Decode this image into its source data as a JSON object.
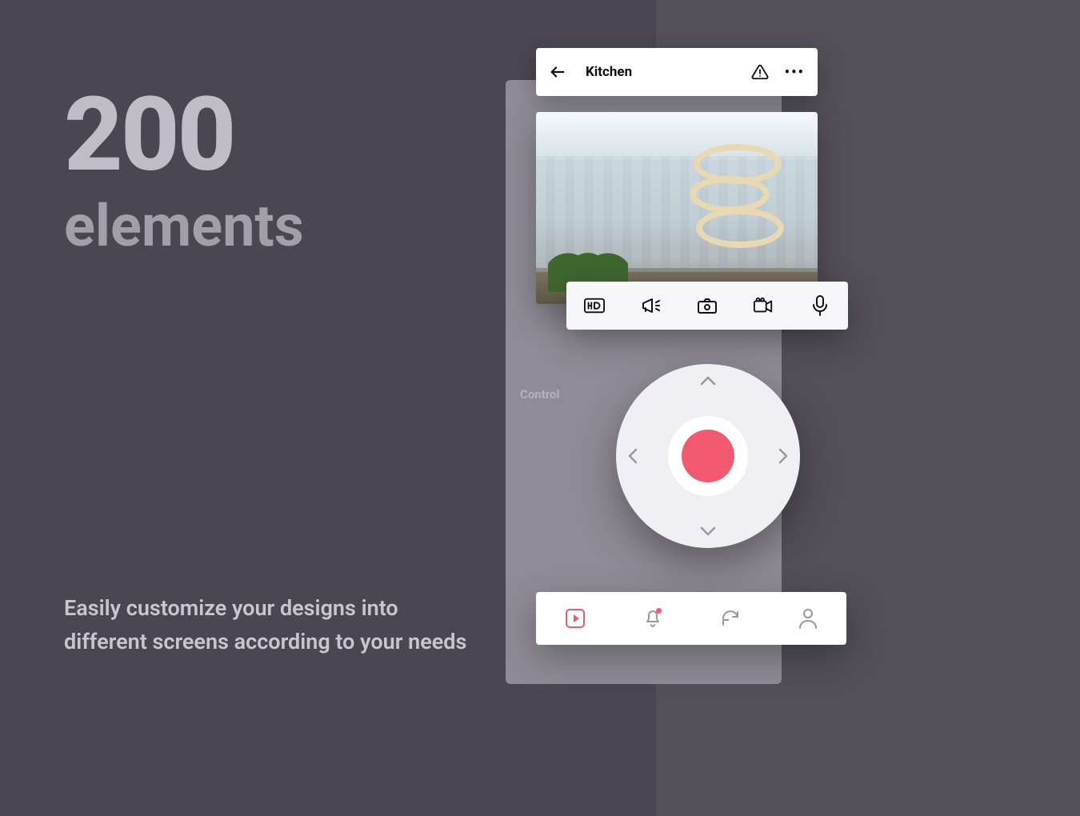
{
  "marketing": {
    "count": "200",
    "count_word": "elements",
    "subtitle": "Easily customize your designs into different screens according to your needs"
  },
  "appbar": {
    "title": "Kitchen"
  },
  "media_icons": {
    "hd": "hd-icon",
    "speaker": "megaphone-icon",
    "camera": "camera-icon",
    "video": "video-camera-icon",
    "mic": "microphone-icon"
  },
  "control": {
    "label": "Control"
  },
  "nav": {
    "play": "play-icon",
    "bell": "bell-icon",
    "refresh": "refresh-icon",
    "user": "user-icon"
  },
  "colors": {
    "bg": "#4a4652",
    "bg_strip": "#54505a",
    "phone": "#908c97",
    "accent": "#f25870",
    "muted": "#a39fa9"
  }
}
